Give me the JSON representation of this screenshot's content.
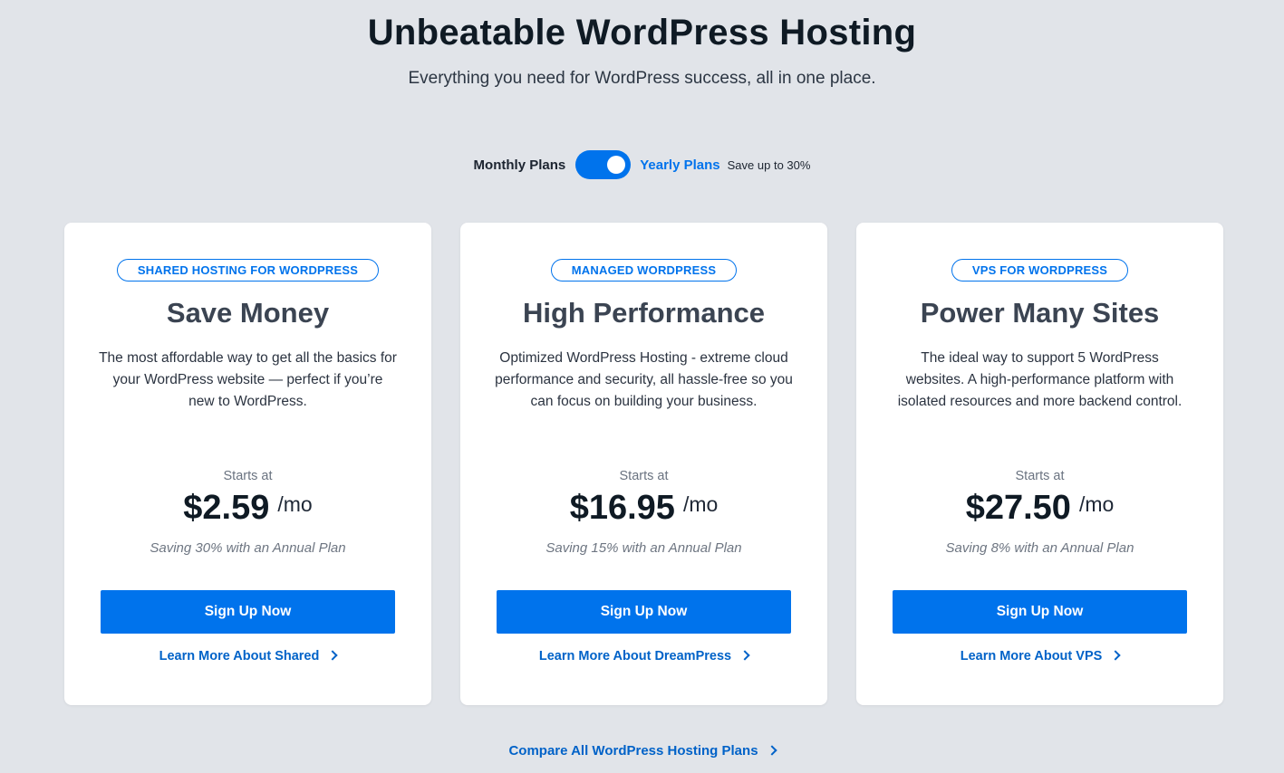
{
  "hero": {
    "title": "Unbeatable WordPress Hosting",
    "subtitle": "Everything you need for WordPress success, all in one place."
  },
  "billing_toggle": {
    "monthly_label": "Monthly Plans",
    "yearly_label": "Yearly Plans",
    "save_note": "Save up to 30%",
    "selected": "yearly",
    "accent_color": "#0073ec"
  },
  "plans": [
    {
      "badge": "SHARED HOSTING FOR WORDPRESS",
      "title": "Save Money",
      "description": "The most affordable way to get all the basics for your WordPress website — perfect if you’re new to WordPress.",
      "starts_at": "Starts at",
      "price": "$2.59",
      "period": "/mo",
      "saving": "Saving 30% with an Annual Plan",
      "cta": "Sign Up Now",
      "learn_more": "Learn More About Shared"
    },
    {
      "badge": "MANAGED WORDPRESS",
      "title": "High Performance",
      "description": "Optimized WordPress Hosting - extreme cloud performance and security, all hassle-free so you can focus on building your business.",
      "starts_at": "Starts at",
      "price": "$16.95",
      "period": "/mo",
      "saving": "Saving 15% with an Annual Plan",
      "cta": "Sign Up Now",
      "learn_more": "Learn More About DreamPress"
    },
    {
      "badge": "VPS FOR WORDPRESS",
      "title": "Power Many Sites",
      "description": "The ideal way to support 5 WordPress websites. A high-performance platform with isolated resources and more backend control.",
      "starts_at": "Starts at",
      "price": "$27.50",
      "period": "/mo",
      "saving": "Saving 8% with an Annual Plan",
      "cta": "Sign Up Now",
      "learn_more": "Learn More About VPS"
    }
  ],
  "compare_link": "Compare All WordPress Hosting Plans",
  "icons": {
    "link_arrow": "chevron-right-icon"
  },
  "colors": {
    "background": "#e1e4e9",
    "primary_blue": "#0073ec",
    "link_blue": "#0062c8",
    "card_bg": "#ffffff"
  }
}
